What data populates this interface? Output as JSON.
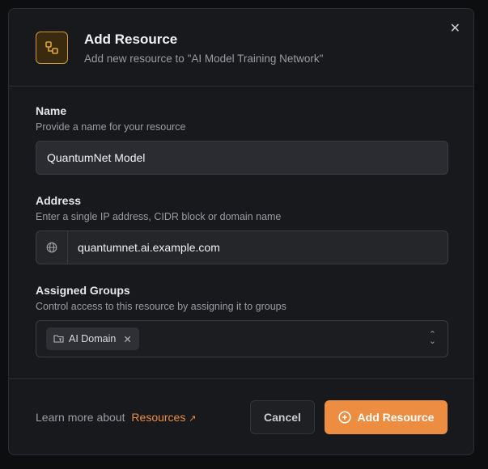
{
  "dialog": {
    "title": "Add Resource",
    "subtitle": "Add new resource to \"AI Model Training Network\""
  },
  "name": {
    "label": "Name",
    "hint": "Provide a name for your resource",
    "value": "QuantumNet Model"
  },
  "address": {
    "label": "Address",
    "hint": "Enter a single IP address, CIDR block or domain name",
    "value": "quantumnet.ai.example.com"
  },
  "groups": {
    "label": "Assigned Groups",
    "hint": "Control access to this resource by assigning it to groups",
    "chips": [
      "AI Domain"
    ]
  },
  "footer": {
    "learn_prefix": "Learn more about",
    "learn_link": "Resources",
    "cancel": "Cancel",
    "submit": "Add Resource"
  },
  "colors": {
    "accent": "#ec8d41",
    "icon_border": "#d29a2b"
  }
}
